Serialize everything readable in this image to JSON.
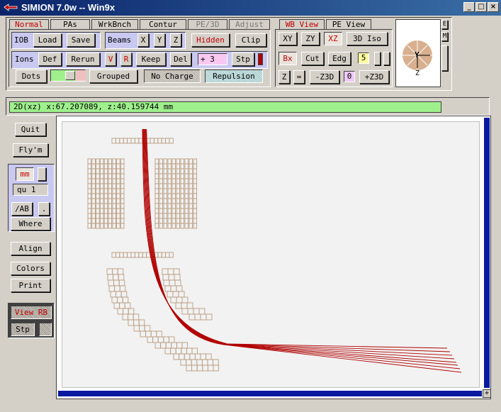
{
  "window": {
    "title": "SIMION 7.0w -- Win9x",
    "controls": [
      "_",
      "□",
      "×"
    ]
  },
  "tabs": [
    "Normal",
    "PAs",
    "WrkBnch",
    "Contur",
    "PE/3D",
    "Adjust"
  ],
  "active_tab": "Normal",
  "row1": {
    "iob_label": "IOB",
    "load": "Load",
    "save": "Save",
    "beams_label": "Beams",
    "x": "X",
    "y": "Y",
    "z": "Z",
    "hidden": "Hidden",
    "clip": "Clip"
  },
  "row2": {
    "ions_label": "Ions",
    "def": "Def",
    "rerun": "Rerun",
    "v": "V",
    "r": "R",
    "keep": "Keep",
    "del": "Del",
    "count": "+  3",
    "stp": "Stp"
  },
  "row3": {
    "dots": "Dots",
    "grouped": "Grouped",
    "no_charge": "No Charge",
    "repulsion": "Repulsion"
  },
  "view_tabs": [
    "WB View",
    "PE View"
  ],
  "view": {
    "xy": "XY",
    "zy": "ZY",
    "xz": "XZ",
    "iso": "3D Iso",
    "bx": "Bx",
    "cut": "Cut",
    "edg": "Edg",
    "level": "5",
    "z": "Z",
    "eq": "=",
    "minus_z3d": "-Z3D",
    "zero": "0",
    "plus_z3d": "+Z3D"
  },
  "orient": {
    "center": "Y",
    "bottom": "Z",
    "side_e": "E",
    "side_m": "M"
  },
  "status_text": "2D(xz) x:67.207089, z:40.159744 mm",
  "left": {
    "quit": "Quit",
    "flym": "Fly'm",
    "units": "mm",
    "qu": "qu  1",
    "ab": "/AB",
    "dot": ".",
    "where": "Where",
    "align": "Align",
    "colors": "Colors",
    "print": "Print",
    "view_rb": "View RB",
    "stp": "Stp"
  },
  "colors": {
    "trajectory": "#b00000",
    "electrode": "#b89c80",
    "status_bg": "#9ef08c",
    "scroll": "#0a1aa0"
  }
}
